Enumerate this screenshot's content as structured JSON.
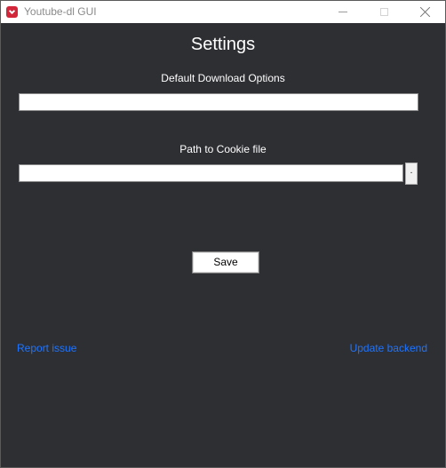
{
  "window": {
    "title": "Youtube-dl GUI"
  },
  "settings": {
    "heading": "Settings",
    "download_options_label": "Default Download Options",
    "download_options_value": "",
    "cookie_label": "Path to Cookie file",
    "cookie_value": "",
    "browse_label": ".",
    "save_label": "Save"
  },
  "links": {
    "report_issue": "Report issue",
    "update_backend": "Update backend"
  },
  "icons": {
    "app": "youtube-dl-icon",
    "minimize": "minimize-icon",
    "maximize": "maximize-icon",
    "close": "close-icon"
  },
  "colors": {
    "background": "#2e2f33",
    "link": "#1e74ff",
    "app_icon": "#d2263b"
  }
}
